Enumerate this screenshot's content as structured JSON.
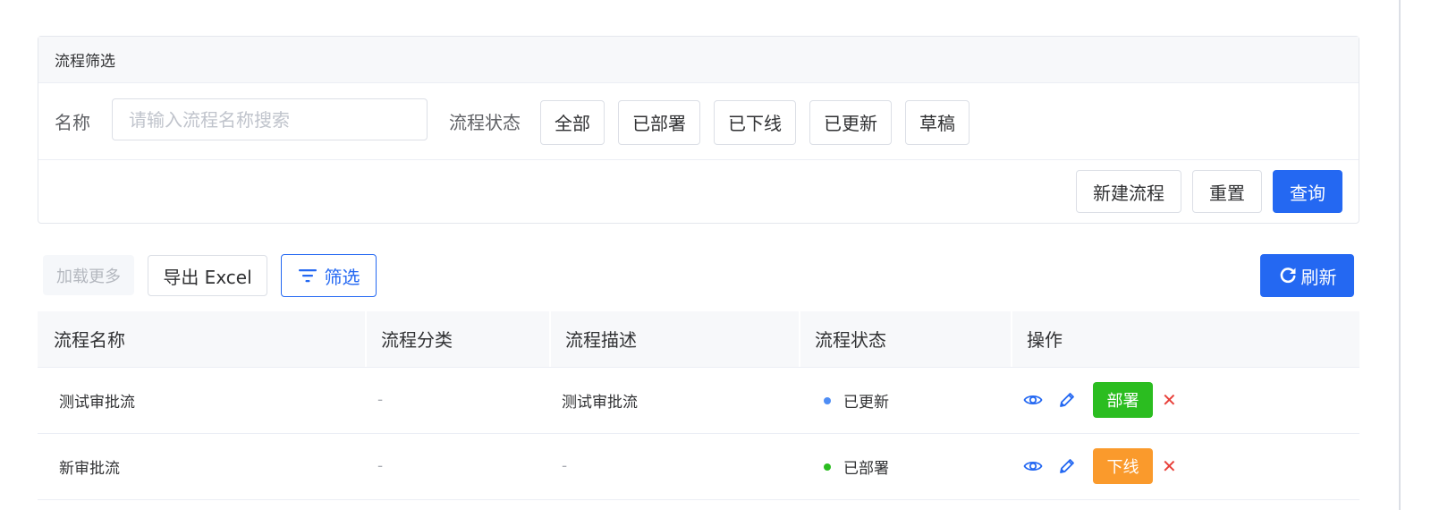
{
  "filter": {
    "title": "流程筛选",
    "name_label": "名称",
    "name_placeholder": "请输入流程名称搜索",
    "name_value": "",
    "status_label": "流程状态",
    "status_options": [
      "全部",
      "已部署",
      "已下线",
      "已更新",
      "草稿"
    ],
    "actions": {
      "new_label": "新建流程",
      "reset_label": "重置",
      "query_label": "查询"
    }
  },
  "toolbar": {
    "load_more_label": "加载更多",
    "export_label": "导出 Excel",
    "filter_label": "筛选",
    "refresh_label": "刷新"
  },
  "table": {
    "columns": [
      "流程名称",
      "流程分类",
      "流程描述",
      "流程状态",
      "操作"
    ],
    "rows": [
      {
        "name": "测试审批流",
        "category": "-",
        "description": "测试审批流",
        "status": "已更新",
        "status_color": "#4e8df5",
        "action_label": "部署",
        "action_color": "#2bbd20"
      },
      {
        "name": "新审批流",
        "category": "-",
        "description": "-",
        "status": "已部署",
        "status_color": "#2bbd20",
        "action_label": "下线",
        "action_color": "#fa9a2c"
      }
    ],
    "row_icons": [
      "view-icon",
      "edit-icon",
      "delete-icon"
    ],
    "delete_glyph": "✕"
  },
  "colors": {
    "primary": "#2468f2",
    "danger": "#e8403a"
  }
}
